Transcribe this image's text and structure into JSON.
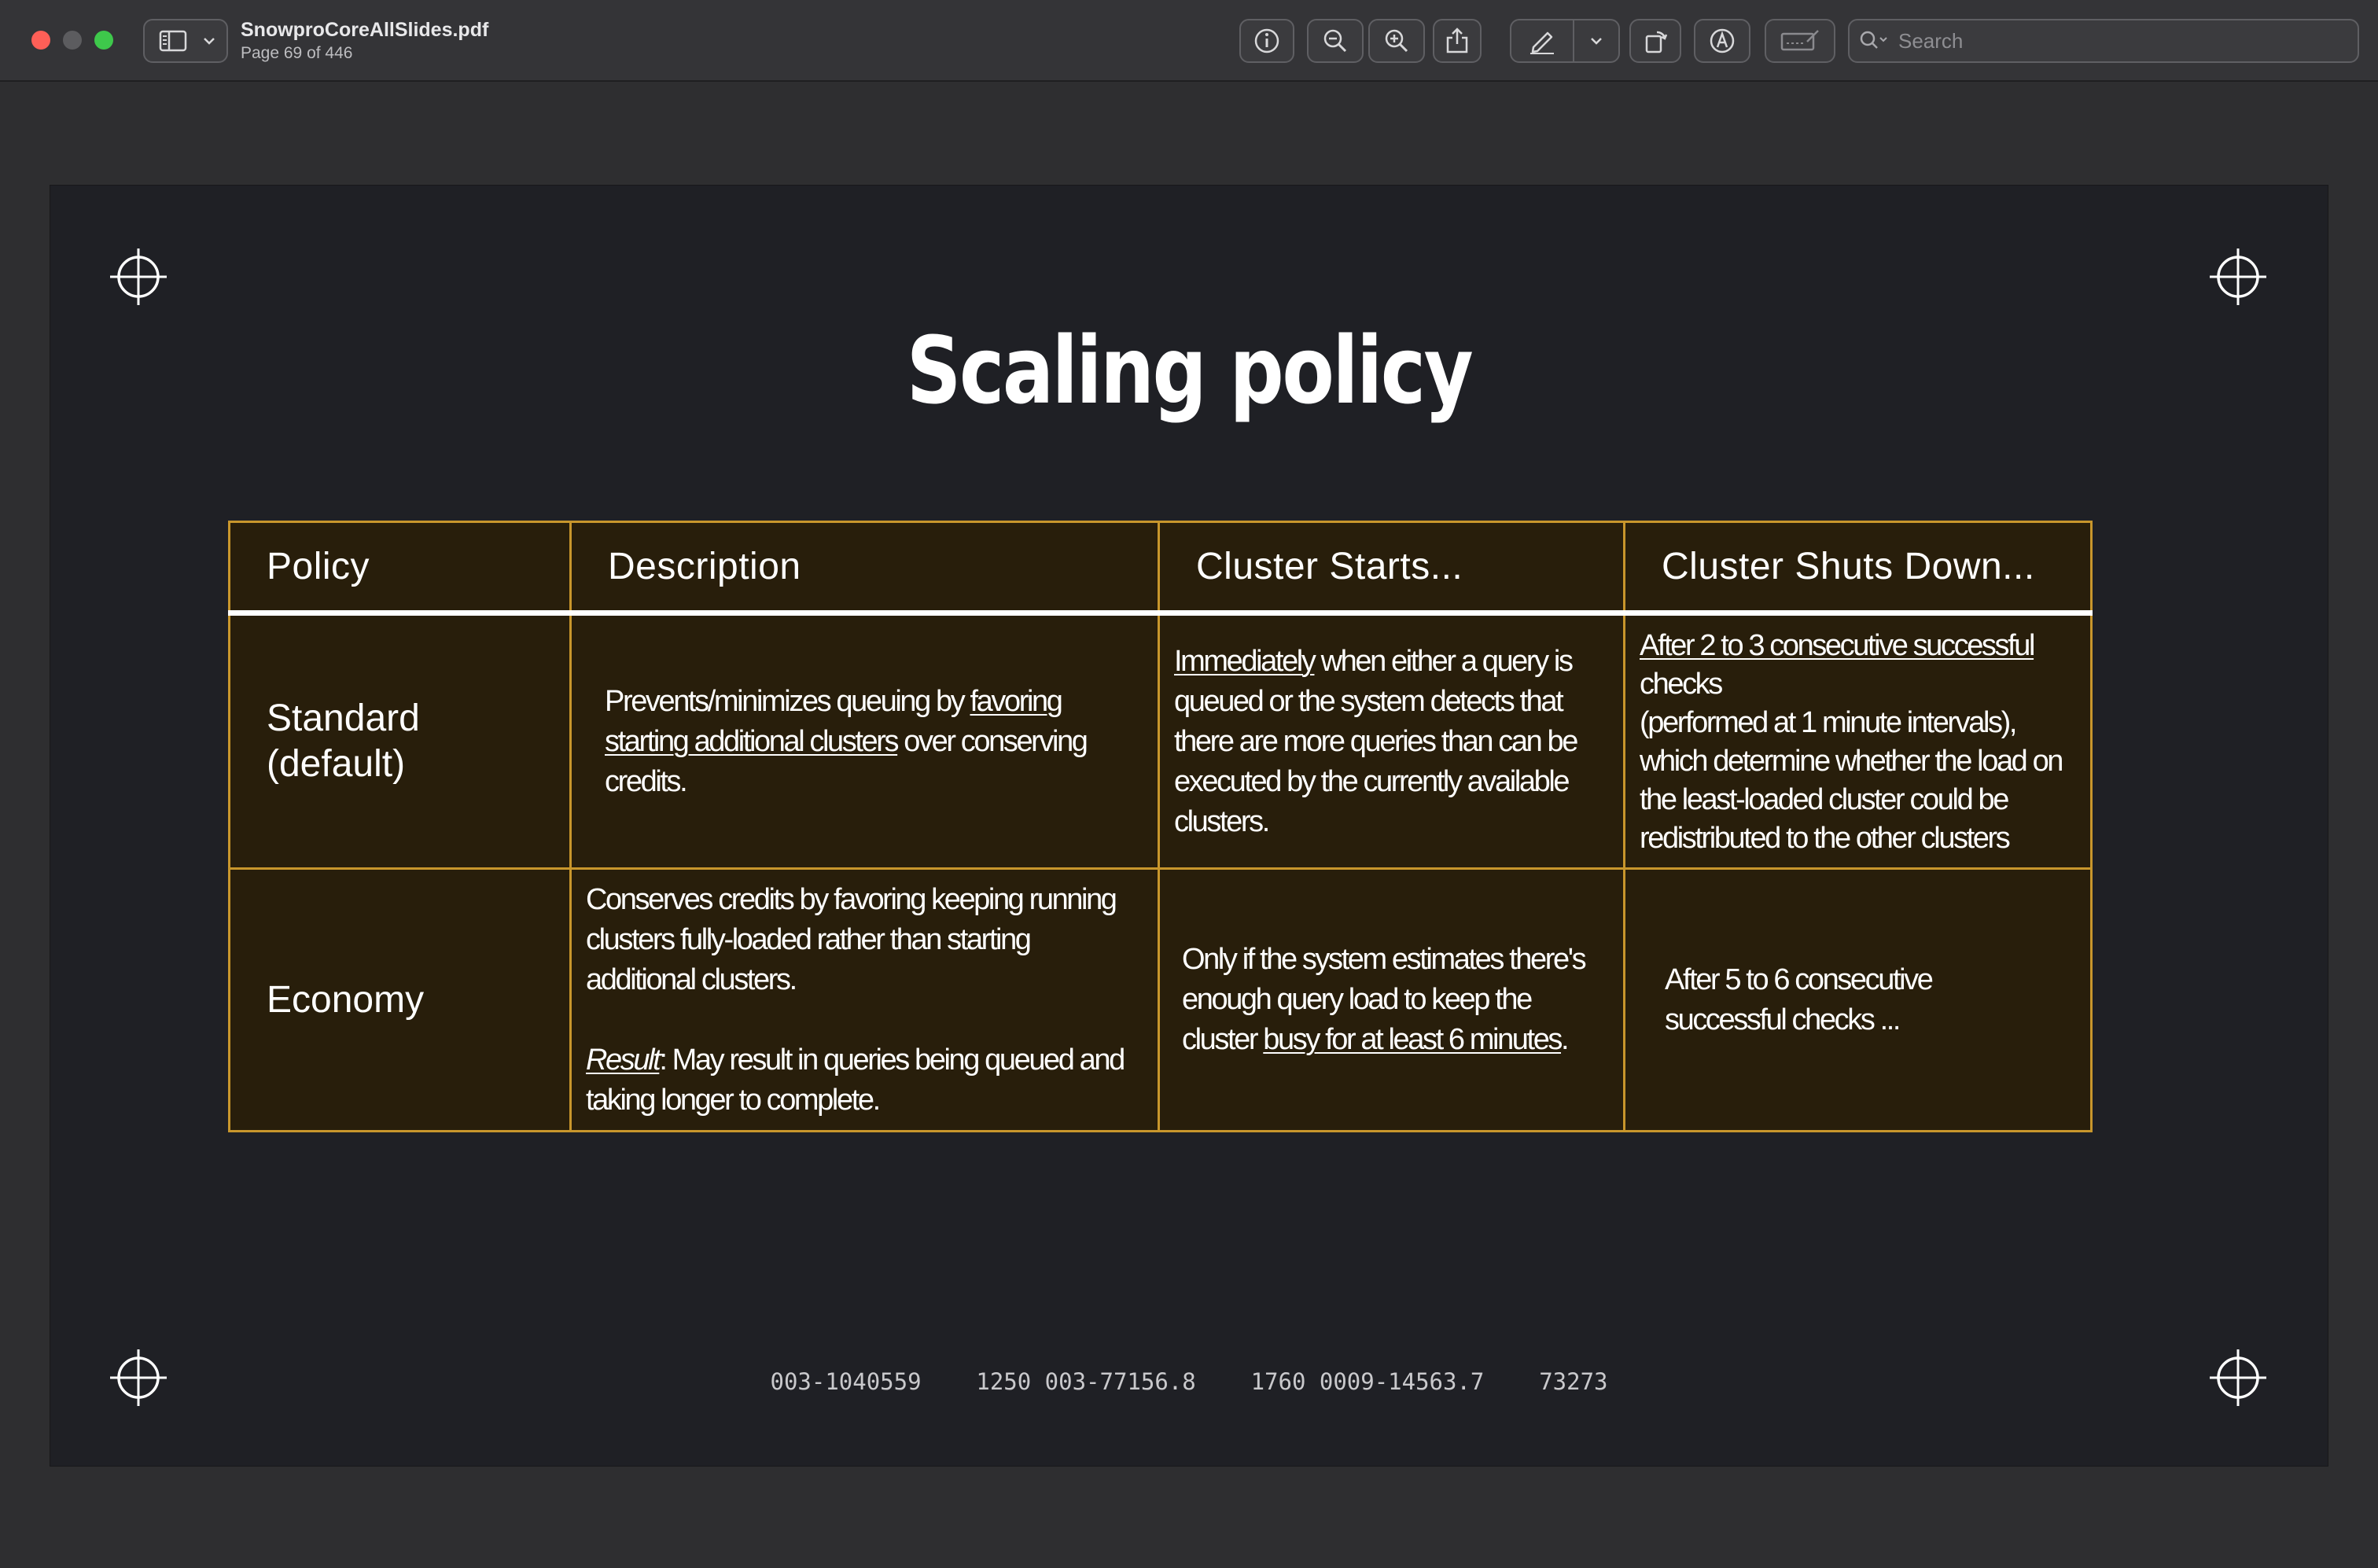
{
  "window": {
    "doc_name": "SnowproCoreAllSlides.pdf",
    "page_status": "Page 69 of 446",
    "search_placeholder": "Search",
    "toolbar_icons": [
      "info-icon",
      "zoom-out-icon",
      "zoom-in-icon",
      "share-icon",
      "markup-pen-icon",
      "chevron-down-icon",
      "rotate-icon",
      "annotate-icon",
      "signature-icon",
      "search-icon"
    ]
  },
  "slide": {
    "title": "Scaling policy",
    "headers": [
      "Policy",
      "Description",
      "Cluster Starts...",
      "Cluster Shuts Down..."
    ],
    "rows": [
      {
        "policy": "Standard (default)",
        "description": {
          "pre": "Prevents/minimizes queuing by ",
          "underlined": "favoring starting additional clusters",
          "post": " over conserving credits."
        },
        "starts": {
          "underlined": "Immediately",
          "post": " when either a query is queued or the system detects that there are more queries than can be executed by the currently available clusters."
        },
        "shuts_down": {
          "underlined": "After 2 to 3 consecutive successful",
          "line2": "checks",
          "line3": "(performed at 1 minute intervals), which determine whether the load on the least-loaded cluster could be redistributed to the other clusters"
        }
      },
      {
        "policy": "Economy",
        "description": {
          "text": "Conserves credits by favoring keeping running clusters fully-loaded rather than starting additional clusters.",
          "result_label": "Result",
          "result_text": ": May result in queries being queued and taking longer to complete."
        },
        "starts": {
          "pre": "Only if the system estimates there's enough query load to keep the cluster ",
          "underlined": "busy for at least 6 minutes",
          "post": "."
        },
        "shuts_down": {
          "text": "After 5 to 6 consecutive successful checks ..."
        }
      }
    ],
    "footer_code": "003-1040559    1250 003-77156.8    1760 0009-14563.7    73273"
  },
  "colors": {
    "table_border": "#c8962c",
    "table_bg": "#281e0b",
    "slide_bg": "#1f2025",
    "close": "#fe5f57",
    "maximize": "#3ec84b"
  }
}
